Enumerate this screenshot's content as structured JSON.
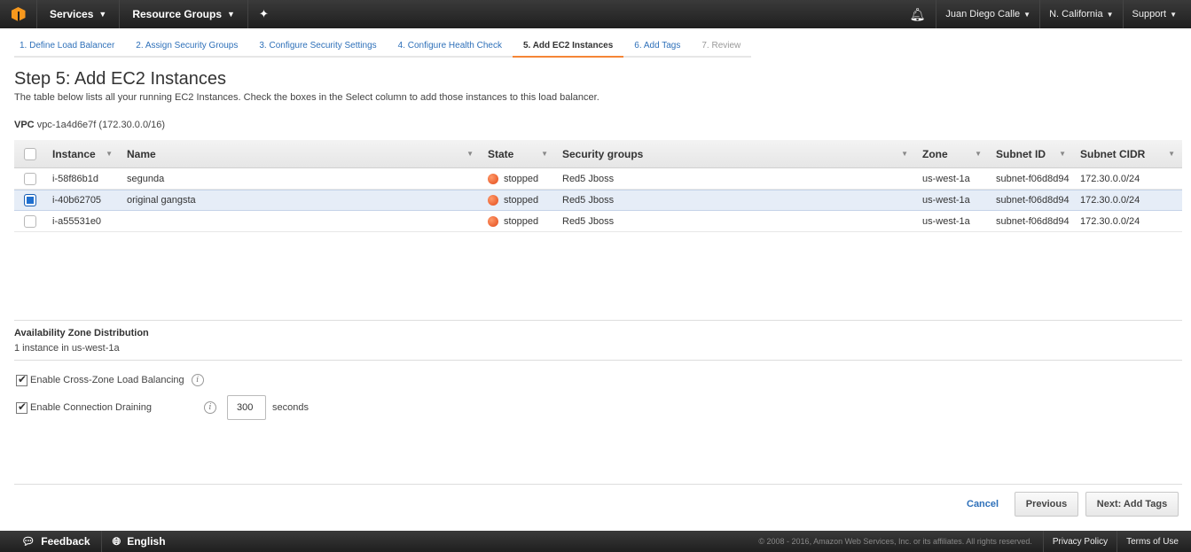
{
  "topnav": {
    "services": "Services",
    "resource_groups": "Resource Groups",
    "user": "Juan Diego Calle",
    "region": "N. California",
    "support": "Support"
  },
  "steps": [
    {
      "label": "1. Define Load Balancer",
      "state": "link"
    },
    {
      "label": "2. Assign Security Groups",
      "state": "link"
    },
    {
      "label": "3. Configure Security Settings",
      "state": "link"
    },
    {
      "label": "4. Configure Health Check",
      "state": "link"
    },
    {
      "label": "5. Add EC2 Instances",
      "state": "active"
    },
    {
      "label": "6. Add Tags",
      "state": "link"
    },
    {
      "label": "7. Review",
      "state": "disabled"
    }
  ],
  "page": {
    "title": "Step 5: Add EC2 Instances",
    "description": "The table below lists all your running EC2 Instances. Check the boxes in the Select column to add those instances to this load balancer.",
    "vpc_label": "VPC",
    "vpc_value": "vpc-1a4d6e7f (172.30.0.0/16)"
  },
  "table": {
    "headers": {
      "instance": "Instance",
      "name": "Name",
      "state": "State",
      "security_groups": "Security groups",
      "zone": "Zone",
      "subnet_id": "Subnet ID",
      "subnet_cidr": "Subnet CIDR"
    },
    "rows": [
      {
        "selected": false,
        "instance": "i-58f86b1d",
        "name": "segunda",
        "state": "stopped",
        "security_groups": "Red5 Jboss",
        "zone": "us-west-1a",
        "subnet_id": "subnet-f06d8d94",
        "subnet_cidr": "172.30.0.0/24"
      },
      {
        "selected": true,
        "instance": "i-40b62705",
        "name": "original gangsta",
        "state": "stopped",
        "security_groups": "Red5 Jboss",
        "zone": "us-west-1a",
        "subnet_id": "subnet-f06d8d94",
        "subnet_cidr": "172.30.0.0/24"
      },
      {
        "selected": false,
        "instance": "i-a55531e0",
        "name": "",
        "state": "stopped",
        "security_groups": "Red5 Jboss",
        "zone": "us-west-1a",
        "subnet_id": "subnet-f06d8d94",
        "subnet_cidr": "172.30.0.0/24"
      }
    ]
  },
  "availability": {
    "title": "Availability Zone Distribution",
    "text": "1 instance in us-west-1a"
  },
  "options": {
    "cross_zone": "Enable Cross-Zone Load Balancing",
    "cross_zone_checked": true,
    "draining": "Enable Connection Draining",
    "draining_checked": true,
    "draining_value": "300",
    "draining_unit": "seconds"
  },
  "buttons": {
    "cancel": "Cancel",
    "previous": "Previous",
    "next": "Next: Add Tags"
  },
  "footer": {
    "feedback": "Feedback",
    "language": "English",
    "copyright": "© 2008 - 2016, Amazon Web Services, Inc. or its affiliates. All rights reserved.",
    "privacy": "Privacy Policy",
    "terms": "Terms of Use"
  }
}
